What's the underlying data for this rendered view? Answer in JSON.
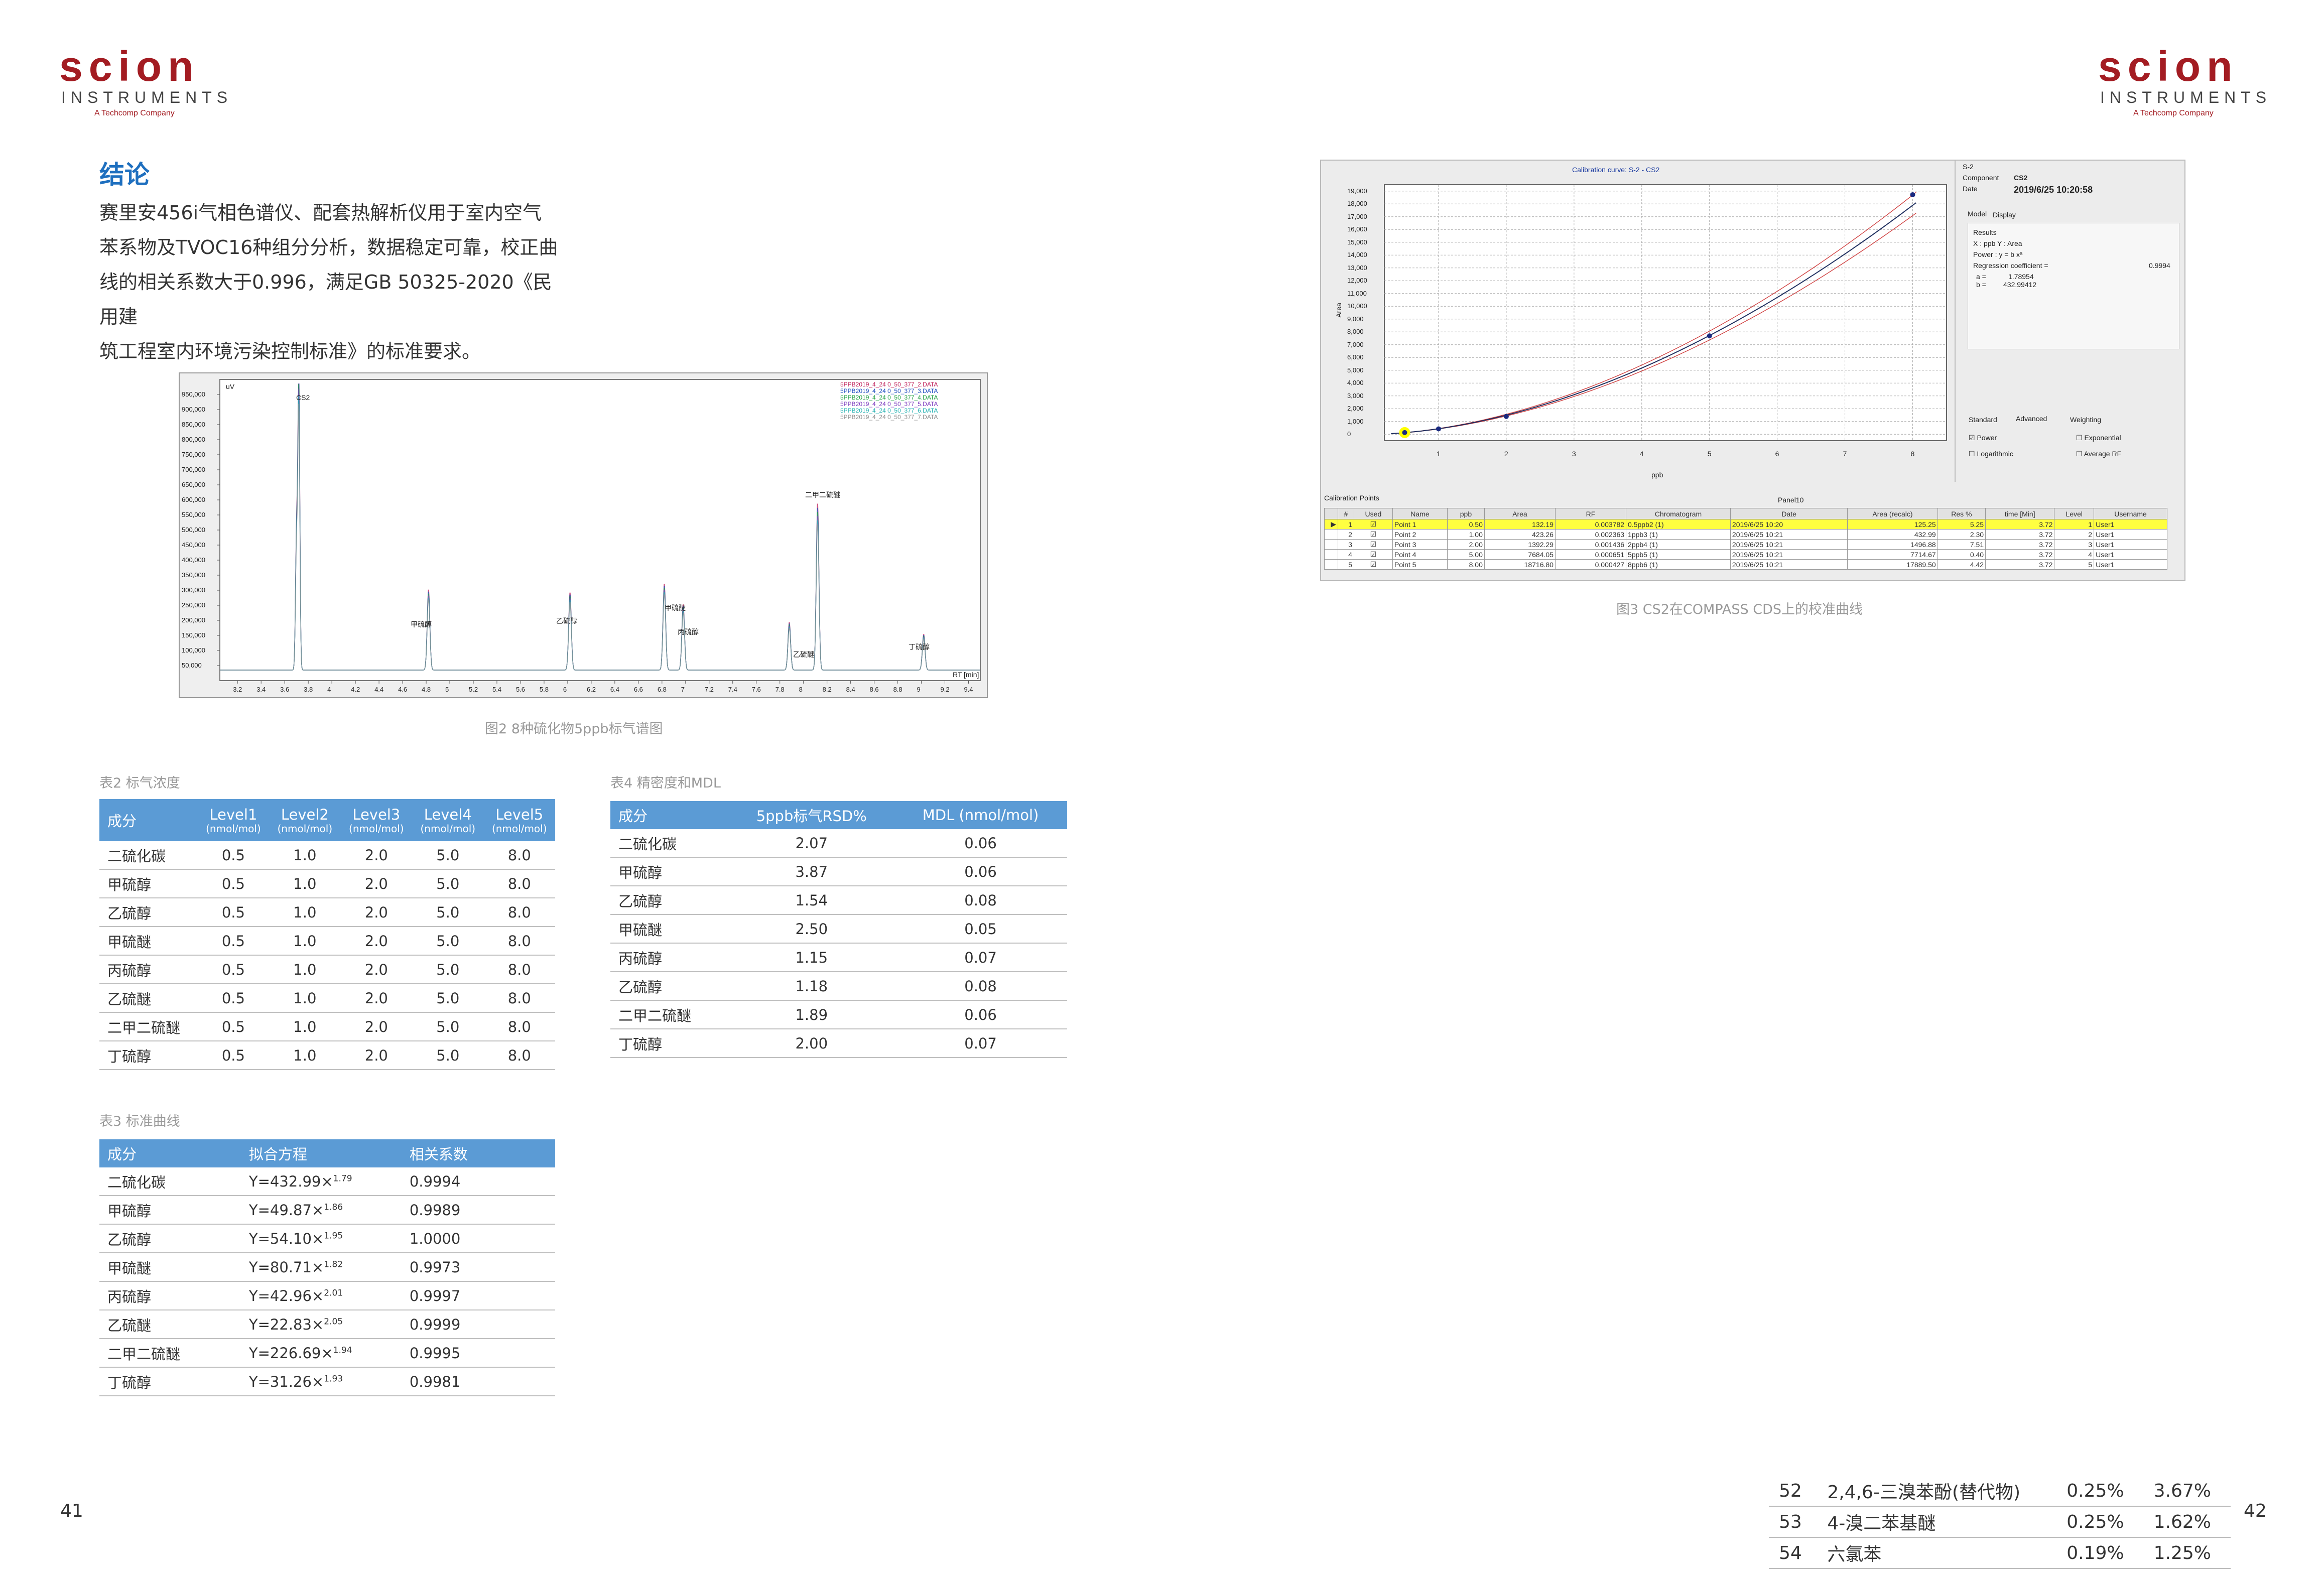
{
  "logo": {
    "word": "scion",
    "sub": "INSTRUMENTS",
    "tagline": "A Techcomp Company"
  },
  "section": {
    "title": "结论",
    "paragraph": [
      "赛里安456i气相色谱仪、配套热解析仪用于室内空气",
      "苯系物及TVOC16种组分分析，数据稳定可靠，校正曲",
      "线的相关系数大于0.996，满足GB 50325-2020《民用建",
      "筑工程室内环境污染控制标准》的标准要求。"
    ]
  },
  "figure2": {
    "caption": "图2  8种硫化物5ppb标气谱图",
    "ylabel": "uV",
    "yticks": [
      "950,000",
      "900,000",
      "850,000",
      "800,000",
      "750,000",
      "700,000",
      "650,000",
      "600,000",
      "550,000",
      "500,000",
      "450,000",
      "400,000",
      "350,000",
      "300,000",
      "250,000",
      "200,000",
      "150,000",
      "100,000",
      "50,000"
    ],
    "xticks": [
      "3.2",
      "3.4",
      "3.6",
      "3.8",
      "4",
      "4.2",
      "4.4",
      "4.6",
      "4.8",
      "5",
      "5.2",
      "5.4",
      "5.6",
      "5.8",
      "6",
      "6.2",
      "6.4",
      "6.6",
      "6.8",
      "7",
      "7.2",
      "7.4",
      "7.6",
      "7.8",
      "8",
      "8.2",
      "8.4",
      "8.6",
      "8.8",
      "9",
      "9.2",
      "9.4"
    ],
    "xunit": "RT [min]",
    "legend": [
      "5PPB2019_4_24 0_50_377_2.DATA",
      "5PPB2019_4_24 0_50_377_3.DATA",
      "5PPB2019_4_24 0_50_377_4.DATA",
      "5PPB2019_4_24 0_50_377_5.DATA",
      "5PPB2019_4_24 0_50_377_6.DATA",
      "5PPB2019_4_24 0_50_377_7.DATA"
    ],
    "peak_labels": [
      "CS2",
      "甲硫醇",
      "乙硫醇",
      "甲硫醚",
      "丙硫醇",
      "二甲二硫醚",
      "乙硫醚",
      "丁硫醇"
    ],
    "colors": [
      "#c0205a",
      "#2050c0",
      "#20a040",
      "#8040c0",
      "#20b0b0",
      "#909090"
    ]
  },
  "figure3": {
    "caption": "图3  CS2在COMPASS CDS上的校准曲线",
    "title": "Calibration curve: S-2 - CS2",
    "ylabel": "Area",
    "xlabel": "ppb",
    "yticks": [
      "19,000",
      "18,000",
      "17,000",
      "16,000",
      "15,000",
      "14,000",
      "13,000",
      "12,000",
      "11,000",
      "10,000",
      "9,000",
      "8,000",
      "7,000",
      "6,000",
      "5,000",
      "4,000",
      "3,000",
      "2,000",
      "1,000",
      "0"
    ],
    "xticks": [
      "1",
      "2",
      "3",
      "4",
      "5",
      "6",
      "7",
      "8"
    ],
    "side": {
      "s": "S-2",
      "component_label": "Component",
      "component": "CS2",
      "date_label": "Date",
      "date": "2019/6/25 10:20:58",
      "tabs": [
        "Model",
        "Display"
      ],
      "results_title": "Results",
      "xy": "X : ppb    Y : Area",
      "power": "Power : y = b xª",
      "reg_label": "Regression coefficient =",
      "reg": "0.9994",
      "a_label": "a =",
      "a": "1.78954",
      "b_label": "b =",
      "b": "432.99412",
      "tabs2": [
        "Standard",
        "Advanced",
        "Weighting"
      ],
      "opts": [
        "Power",
        "Exponential",
        "Logarithmic",
        "Average RF"
      ]
    },
    "points_title": "Calibration Points",
    "panel_title": "Panel10",
    "columns": [
      "#",
      "Used",
      "Name",
      "ppb",
      "Area",
      "RF",
      "Chromatogram",
      "Date",
      "Area (recalc)",
      "Res %",
      "time [Min]",
      "Level",
      "Username"
    ],
    "rows": [
      [
        "1",
        "☑",
        "Point 1",
        "0.50",
        "132.19",
        "0.003782",
        "0.5ppb2 (1)",
        "2019/6/25 10:20",
        "125.25",
        "5.25",
        "3.72",
        "1",
        "User1"
      ],
      [
        "2",
        "☑",
        "Point 2",
        "1.00",
        "423.26",
        "0.002363",
        "1ppb3 (1)",
        "2019/6/25 10:21",
        "432.99",
        "2.30",
        "3.72",
        "2",
        "User1"
      ],
      [
        "3",
        "☑",
        "Point 3",
        "2.00",
        "1392.29",
        "0.001436",
        "2ppb4 (1)",
        "2019/6/25 10:21",
        "1496.88",
        "7.51",
        "3.72",
        "3",
        "User1"
      ],
      [
        "4",
        "☑",
        "Point 4",
        "5.00",
        "7684.05",
        "0.000651",
        "5ppb5 (1)",
        "2019/6/25 10:21",
        "7714.67",
        "0.40",
        "3.72",
        "4",
        "User1"
      ],
      [
        "5",
        "☑",
        "Point 5",
        "8.00",
        "18716.80",
        "0.000427",
        "8ppb6 (1)",
        "2019/6/25 10:21",
        "17889.50",
        "4.42",
        "3.72",
        "5",
        "User1"
      ]
    ]
  },
  "table2": {
    "caption": "表2  标气浓度",
    "headers": [
      "成分",
      "Level1",
      "Level2",
      "Level3",
      "Level4",
      "Level5"
    ],
    "unit": "(nmol/mol)",
    "rows": [
      [
        "二硫化碳",
        "0.5",
        "1.0",
        "2.0",
        "5.0",
        "8.0"
      ],
      [
        "甲硫醇",
        "0.5",
        "1.0",
        "2.0",
        "5.0",
        "8.0"
      ],
      [
        "乙硫醇",
        "0.5",
        "1.0",
        "2.0",
        "5.0",
        "8.0"
      ],
      [
        "甲硫醚",
        "0.5",
        "1.0",
        "2.0",
        "5.0",
        "8.0"
      ],
      [
        "丙硫醇",
        "0.5",
        "1.0",
        "2.0",
        "5.0",
        "8.0"
      ],
      [
        "乙硫醚",
        "0.5",
        "1.0",
        "2.0",
        "5.0",
        "8.0"
      ],
      [
        "二甲二硫醚",
        "0.5",
        "1.0",
        "2.0",
        "5.0",
        "8.0"
      ],
      [
        "丁硫醇",
        "0.5",
        "1.0",
        "2.0",
        "5.0",
        "8.0"
      ]
    ]
  },
  "table3": {
    "caption": "表3  标准曲线",
    "headers": [
      "成分",
      "拟合方程",
      "相关系数"
    ],
    "rows": [
      [
        "二硫化碳",
        "Y=432.99×",
        "1.79",
        "0.9994"
      ],
      [
        "甲硫醇",
        "Y=49.87×",
        "1.86",
        "0.9989"
      ],
      [
        "乙硫醇",
        "Y=54.10×",
        "1.95",
        "1.0000"
      ],
      [
        "甲硫醚",
        "Y=80.71×",
        "1.82",
        "0.9973"
      ],
      [
        "丙硫醇",
        "Y=42.96×",
        "2.01",
        "0.9997"
      ],
      [
        "乙硫醚",
        "Y=22.83×",
        "2.05",
        "0.9999"
      ],
      [
        "二甲二硫醚",
        "Y=226.69×",
        "1.94",
        "0.9995"
      ],
      [
        "丁硫醇",
        "Y=31.26×",
        "1.93",
        "0.9981"
      ]
    ]
  },
  "table4": {
    "caption": "表4  精密度和MDL",
    "headers": [
      "成分",
      "5ppb标气RSD%",
      "MDL (nmol/mol)"
    ],
    "rows": [
      [
        "二硫化碳",
        "2.07",
        "0.06"
      ],
      [
        "甲硫醇",
        "3.87",
        "0.06"
      ],
      [
        "乙硫醇",
        "1.54",
        "0.08"
      ],
      [
        "甲硫醚",
        "2.50",
        "0.05"
      ],
      [
        "丙硫醇",
        "1.15",
        "0.07"
      ],
      [
        "乙硫醇",
        "1.18",
        "0.08"
      ],
      [
        "二甲二硫醚",
        "1.89",
        "0.06"
      ],
      [
        "丁硫醇",
        "2.00",
        "0.07"
      ]
    ]
  },
  "bottom_table": {
    "rows": [
      [
        "52",
        "2,4,6-三溴苯酚(替代物)",
        "0.25%",
        "3.67%"
      ],
      [
        "53",
        "4-溴二苯基醚",
        "0.25%",
        "1.62%"
      ],
      [
        "54",
        "六氯苯",
        "0.19%",
        "1.25%"
      ]
    ]
  },
  "pages": {
    "left": "41",
    "right": "42"
  }
}
